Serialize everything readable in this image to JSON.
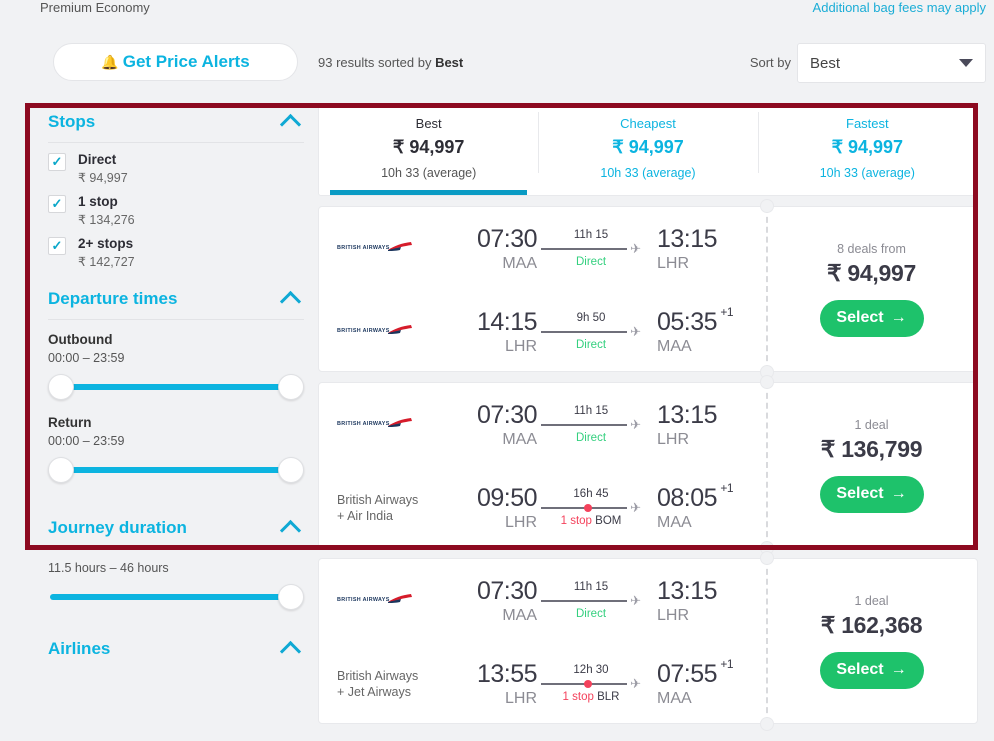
{
  "header": {
    "cabin_class": "Premium Economy",
    "bag_fees_link": "Additional bag fees may apply",
    "price_alerts_button": "Get Price Alerts",
    "bell_icon": "bell-icon",
    "results_count_prefix": "93 results sorted by ",
    "results_sort_value": "Best",
    "sort_by_label": "Sort by",
    "sort_selected": "Best"
  },
  "colors": {
    "accent_teal": "#0cb4e0",
    "select_green": "#1ec26b",
    "direct_green": "#34d07f",
    "stop_red": "#f4425c",
    "highlight_box": "#8d0a20",
    "text_dark": "#3b3b47"
  },
  "highlight_box": {
    "label": "red-highlight-region"
  },
  "sidebar": {
    "sections": [
      {
        "title": "Stops",
        "collapse_icon": "chevron-up-icon",
        "options": [
          {
            "label": "Direct",
            "price": "₹ 94,997",
            "checked": true
          },
          {
            "label": "1 stop",
            "price": "₹ 134,276",
            "checked": true
          },
          {
            "label": "2+ stops",
            "price": "₹ 142,727",
            "checked": true
          }
        ]
      },
      {
        "title": "Departure times",
        "collapse_icon": "chevron-up-icon",
        "sliders": [
          {
            "label": "Outbound",
            "range": "00:00 – 23:59"
          },
          {
            "label": "Return",
            "range": "00:00 – 23:59"
          }
        ]
      },
      {
        "title": "Journey duration",
        "collapse_icon": "chevron-up-icon",
        "sliders": [
          {
            "label": "",
            "range": "11.5 hours – 46 hours"
          }
        ]
      },
      {
        "title": "Airlines",
        "collapse_icon": "chevron-up-icon"
      }
    ]
  },
  "results": {
    "tabs": [
      {
        "name": "Best",
        "price": "₹ 94,997",
        "sub": "10h 33 (average)",
        "active": true
      },
      {
        "name": "Cheapest",
        "price": "₹ 94,997",
        "sub": "10h 33 (average)",
        "active": false
      },
      {
        "name": "Fastest",
        "price": "₹ 94,997",
        "sub": "10h 33 (average)",
        "active": false
      }
    ],
    "cards": [
      {
        "legs": [
          {
            "logo": "british-airways-logo",
            "airline_name": "",
            "depart_time": "07:30",
            "depart_code": "MAA",
            "duration": "11h 15",
            "stops": "Direct",
            "stop_code": "",
            "direct": true,
            "arrive_time": "13:15",
            "arrive_day": "",
            "arrive_code": "LHR"
          },
          {
            "logo": "british-airways-logo",
            "airline_name": "",
            "depart_time": "14:15",
            "depart_code": "LHR",
            "duration": "9h 50",
            "stops": "Direct",
            "stop_code": "",
            "direct": true,
            "arrive_time": "05:35",
            "arrive_day": "+1",
            "arrive_code": "MAA"
          }
        ],
        "deals": "8 deals from",
        "price": "₹ 94,997",
        "select_label": "Select",
        "select_icon": "arrow-right-icon"
      },
      {
        "legs": [
          {
            "logo": "british-airways-logo",
            "airline_name": "",
            "depart_time": "07:30",
            "depart_code": "MAA",
            "duration": "11h 15",
            "stops": "Direct",
            "stop_code": "",
            "direct": true,
            "arrive_time": "13:15",
            "arrive_day": "",
            "arrive_code": "LHR"
          },
          {
            "logo": "",
            "airline_name": "British Airways + Air India",
            "depart_time": "09:50",
            "depart_code": "LHR",
            "duration": "16h 45",
            "stops": "1 stop",
            "stop_code": "BOM",
            "direct": false,
            "arrive_time": "08:05",
            "arrive_day": "+1",
            "arrive_code": "MAA"
          }
        ],
        "deals": "1 deal",
        "price": "₹ 136,799",
        "select_label": "Select",
        "select_icon": "arrow-right-icon"
      },
      {
        "legs": [
          {
            "logo": "british-airways-logo",
            "airline_name": "",
            "depart_time": "07:30",
            "depart_code": "MAA",
            "duration": "11h 15",
            "stops": "Direct",
            "stop_code": "",
            "direct": true,
            "arrive_time": "13:15",
            "arrive_day": "",
            "arrive_code": "LHR"
          },
          {
            "logo": "",
            "airline_name": "British Airways + Jet Airways",
            "depart_time": "13:55",
            "depart_code": "LHR",
            "duration": "12h 30",
            "stops": "1 stop",
            "stop_code": "BLR",
            "direct": false,
            "arrive_time": "07:55",
            "arrive_day": "+1",
            "arrive_code": "MAA"
          }
        ],
        "deals": "1 deal",
        "price": "₹ 162,368",
        "select_label": "Select",
        "select_icon": "arrow-right-icon"
      }
    ]
  }
}
